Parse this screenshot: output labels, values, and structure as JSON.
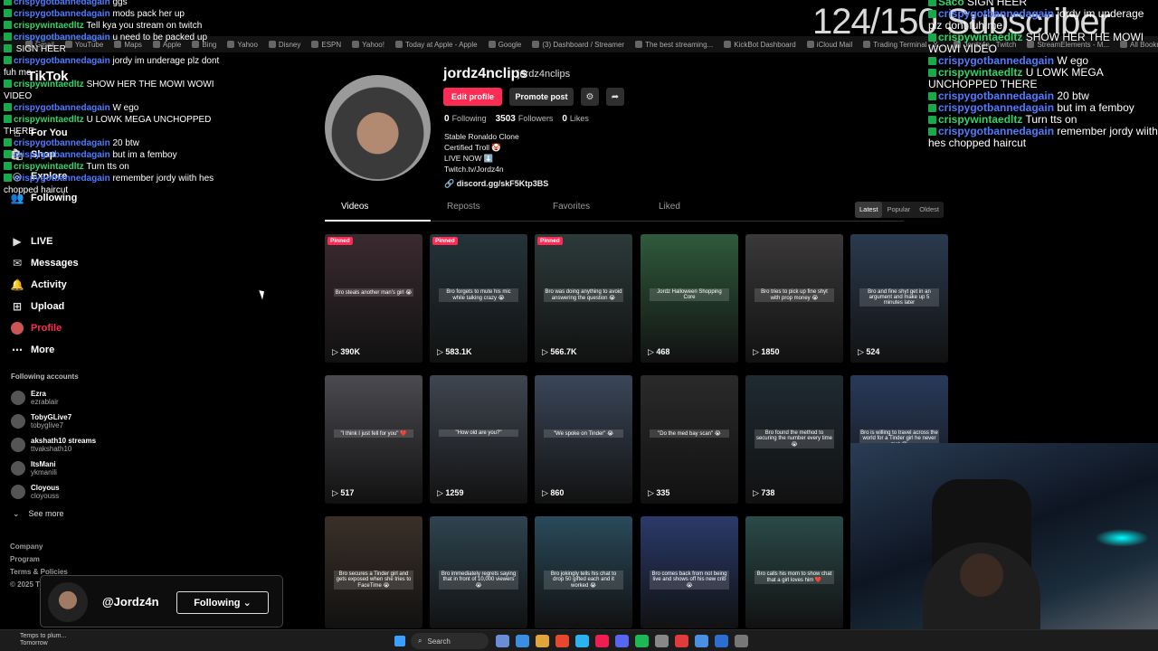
{
  "browser": {
    "bookmarks": [
      "Gmail",
      "YouTube",
      "Maps",
      "Apple",
      "Bing",
      "Yahoo",
      "Disney",
      "ESPN",
      "Yahoo!",
      "Today at Apple - Apple",
      "Google",
      "(3) Dashboard / Streamer",
      "The best streaming...",
      "KickBot Dashboard",
      "iCloud Mail",
      "Trading Terminal - Y...",
      "Jordz4n - Twitch",
      "StreamElements - M...",
      "All Bookmarks"
    ]
  },
  "overlay": {
    "sub_counter": "124/150 Subscriber"
  },
  "chat_left": [
    {
      "user": "crispygotbannedagain",
      "msg": "ggs",
      "color": "blue"
    },
    {
      "user": "crispygotbannedagain",
      "msg": "mods pack her up",
      "color": "blue"
    },
    {
      "user": "crispywintaedltz",
      "msg": "Tell kya you stream on twitch",
      "color": "green"
    },
    {
      "user": "crispygotbannedagain",
      "msg": "u need to be packed up",
      "color": "blue"
    },
    {
      "user": "",
      "msg": "SIGN HEER",
      "color": "green"
    },
    {
      "user": "crispygotbannedagain",
      "msg": "jordy im underage plz dont fuh me",
      "color": "blue"
    },
    {
      "user": "crispywintaedltz",
      "msg": "SHOW HER THE MOWI WOWI VIDEO",
      "color": "green"
    },
    {
      "user": "crispygotbannedagain",
      "msg": "W ego",
      "color": "blue"
    },
    {
      "user": "crispywintaedltz",
      "msg": "U LOWK MEGA UNCHOPPED THERE",
      "color": "green"
    },
    {
      "user": "crispygotbannedagain",
      "msg": "20 btw",
      "color": "blue"
    },
    {
      "user": "crispygotbannedagain",
      "msg": "but im a femboy",
      "color": "blue"
    },
    {
      "user": "crispywintaedltz",
      "msg": "Turn tts on",
      "color": "green"
    },
    {
      "user": "crispygotbannedagain",
      "msg": "remember jordy wiith hes chopped haircut",
      "color": "blue"
    }
  ],
  "chat_right": [
    {
      "user": "Saco",
      "msg": "SIGN HEER",
      "color": "green"
    },
    {
      "user": "crispygotbannedagain",
      "msg": "jordy im underage plz dont fuh me",
      "color": "blue"
    },
    {
      "user": "crispywintaedltz",
      "msg": "SHOW HER THE MOWI WOWI VIDEO",
      "color": "green"
    },
    {
      "user": "crispygotbannedagain",
      "msg": "W ego",
      "color": "blue"
    },
    {
      "user": "crispywintaedltz",
      "msg": "U LOWK MEGA UNCHOPPED THERE",
      "color": "green"
    },
    {
      "user": "crispygotbannedagain",
      "msg": "20 btw",
      "color": "blue"
    },
    {
      "user": "crispygotbannedagain",
      "msg": "but im a femboy",
      "color": "blue"
    },
    {
      "user": "crispywintaedltz",
      "msg": "Turn tts on",
      "color": "green"
    },
    {
      "user": "crispygotbannedagain",
      "msg": "remember jordy wiith hes chopped haircut",
      "color": "blue"
    }
  ],
  "sidebar": {
    "logo": "TikTok",
    "items": [
      {
        "label": "For You",
        "icon": "home-icon"
      },
      {
        "label": "Shop",
        "icon": "shop-icon"
      },
      {
        "label": "Explore",
        "icon": "compass-icon"
      },
      {
        "label": "Following",
        "icon": "following-icon"
      },
      {
        "label": "LIVE",
        "icon": "live-icon"
      },
      {
        "label": "Messages",
        "icon": "message-icon"
      },
      {
        "label": "Activity",
        "icon": "activity-icon"
      },
      {
        "label": "Upload",
        "icon": "upload-icon"
      },
      {
        "label": "Profile",
        "icon": "profile-icon"
      },
      {
        "label": "More",
        "icon": "more-icon"
      }
    ],
    "following_title": "Following accounts",
    "accounts": [
      {
        "name": "Ezra",
        "handle": "ezrablair"
      },
      {
        "name": "TobyGLive7",
        "handle": "tobyglive7"
      },
      {
        "name": "akshath10 streams",
        "handle": "ttvakshath10"
      },
      {
        "name": "ItsMani",
        "handle": "ykmanili"
      },
      {
        "name": "Cloyous",
        "handle": "cloyouss"
      }
    ],
    "see_more": "See more",
    "footer": [
      "Company",
      "Program",
      "Terms & Policies",
      "© 2025 TikTok"
    ]
  },
  "profile": {
    "username": "jordz4nclips",
    "nickname": "jordz4nclips",
    "edit_label": "Edit profile",
    "promote_label": "Promote post",
    "following_count": "0",
    "following_label": "Following",
    "followers_count": "3503",
    "followers_label": "Followers",
    "likes_count": "0",
    "likes_label": "Likes",
    "bio": [
      "Stable Ronaldo Clone",
      "Certified Troll 🤡",
      "LIVE NOW ⬇️",
      "Twitch.tv/Jordz4n"
    ],
    "link": "discord.gg/skF5Ktp3BS"
  },
  "tabs": [
    "Videos",
    "Reposts",
    "Favorites",
    "Liked"
  ],
  "sort_tabs": [
    "Latest",
    "Popular",
    "Oldest"
  ],
  "videos": [
    {
      "views": "390K",
      "pinned": true,
      "caption": "Bro steals another man's girl 😭",
      "color": "#3a2a30"
    },
    {
      "views": "583.1K",
      "pinned": true,
      "caption": "Bro forgets to mute his mic while talking crazy 😭",
      "color": "#24343a"
    },
    {
      "views": "566.7K",
      "pinned": true,
      "caption": "Bro was doing anything to avoid answering the question 😭",
      "color": "#2d3a3a"
    },
    {
      "views": "468",
      "pinned": false,
      "caption": "Jordz Halloween Shopping Core",
      "color": "#2f5a3c"
    },
    {
      "views": "1850",
      "pinned": false,
      "caption": "Bro tries to pick up fine shyt with prop money 😭",
      "color": "#3a3838"
    },
    {
      "views": "524",
      "pinned": false,
      "caption": "Bro and fine shyt get in an argument and make up 5 minutes later",
      "color": "#2a3a4e"
    },
    {
      "views": "517",
      "pinned": false,
      "caption": "\"I think I just fell for you\" ❤️",
      "color": "#4a4a50"
    },
    {
      "views": "1259",
      "pinned": false,
      "caption": "\"How old are you?\"",
      "color": "#3f4650"
    },
    {
      "views": "860",
      "pinned": false,
      "caption": "\"We spoke on Tinder\" 😭",
      "color": "#3a4658"
    },
    {
      "views": "335",
      "pinned": false,
      "caption": "\"Do the med bay scan\" 😭",
      "color": "#2a2a2a"
    },
    {
      "views": "738",
      "pinned": false,
      "caption": "Bro found the method to securing the number every time 😭",
      "color": "#1f2a32"
    },
    {
      "views": "",
      "pinned": false,
      "caption": "Bro is willing to travel across the world for a Tinder girl he never met 😭",
      "color": "#283a5a"
    },
    {
      "views": "",
      "pinned": false,
      "caption": "Bro secures a Tinder girl and gets exposed when she tries to FaceTime 😭",
      "color": "#3a3028"
    },
    {
      "views": "",
      "pinned": false,
      "caption": "Bro immediately regrets saying that in front of 10,000 viewers 😭",
      "color": "#2e4450"
    },
    {
      "views": "",
      "pinned": false,
      "caption": "Bro jokingly tells his chat to drop 50 gifted each and it worked 😭",
      "color": "#2a4a5a"
    },
    {
      "views": "",
      "pinned": false,
      "caption": "Bro comes back from not being live and shows off his new crib 😭",
      "color": "#2a3a6a"
    },
    {
      "views": "",
      "pinned": false,
      "caption": "Bro calls his mom to show chat that a girl loves him ❤️",
      "color": "#2a4a48"
    }
  ],
  "follow_card": {
    "name": "@Jordz4n",
    "button": "Following"
  },
  "taskbar": {
    "weather": "Temps to plum...",
    "weather2": "Tomorrow",
    "search": "Search"
  }
}
